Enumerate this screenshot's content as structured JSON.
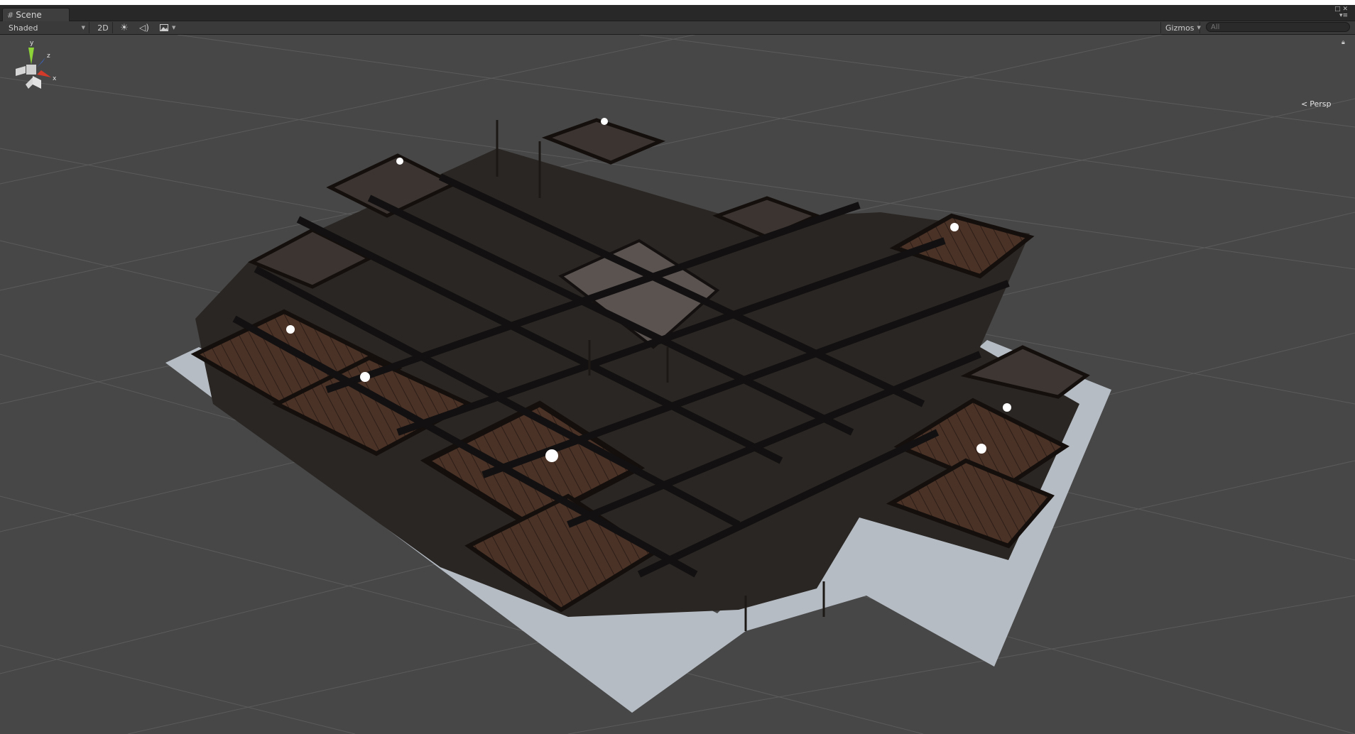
{
  "tab": {
    "title": "Scene",
    "icon": "scene-grid-icon"
  },
  "toolbar": {
    "shading_mode": "Shaded",
    "mode_2d": "2D",
    "gizmos_label": "Gizmos",
    "search_placeholder": "All"
  },
  "orientation_gizmo": {
    "axis_y": "y",
    "axis_z": "z",
    "axis_x": "x",
    "projection": "Persp"
  },
  "colors": {
    "grid_background": "#474747",
    "grid_line": "#5a5a5a",
    "ground_plane": "#b6bcc4",
    "axis_x": "#d33a2a",
    "axis_y": "#8cd437",
    "axis_z": "#3a6ad3"
  }
}
